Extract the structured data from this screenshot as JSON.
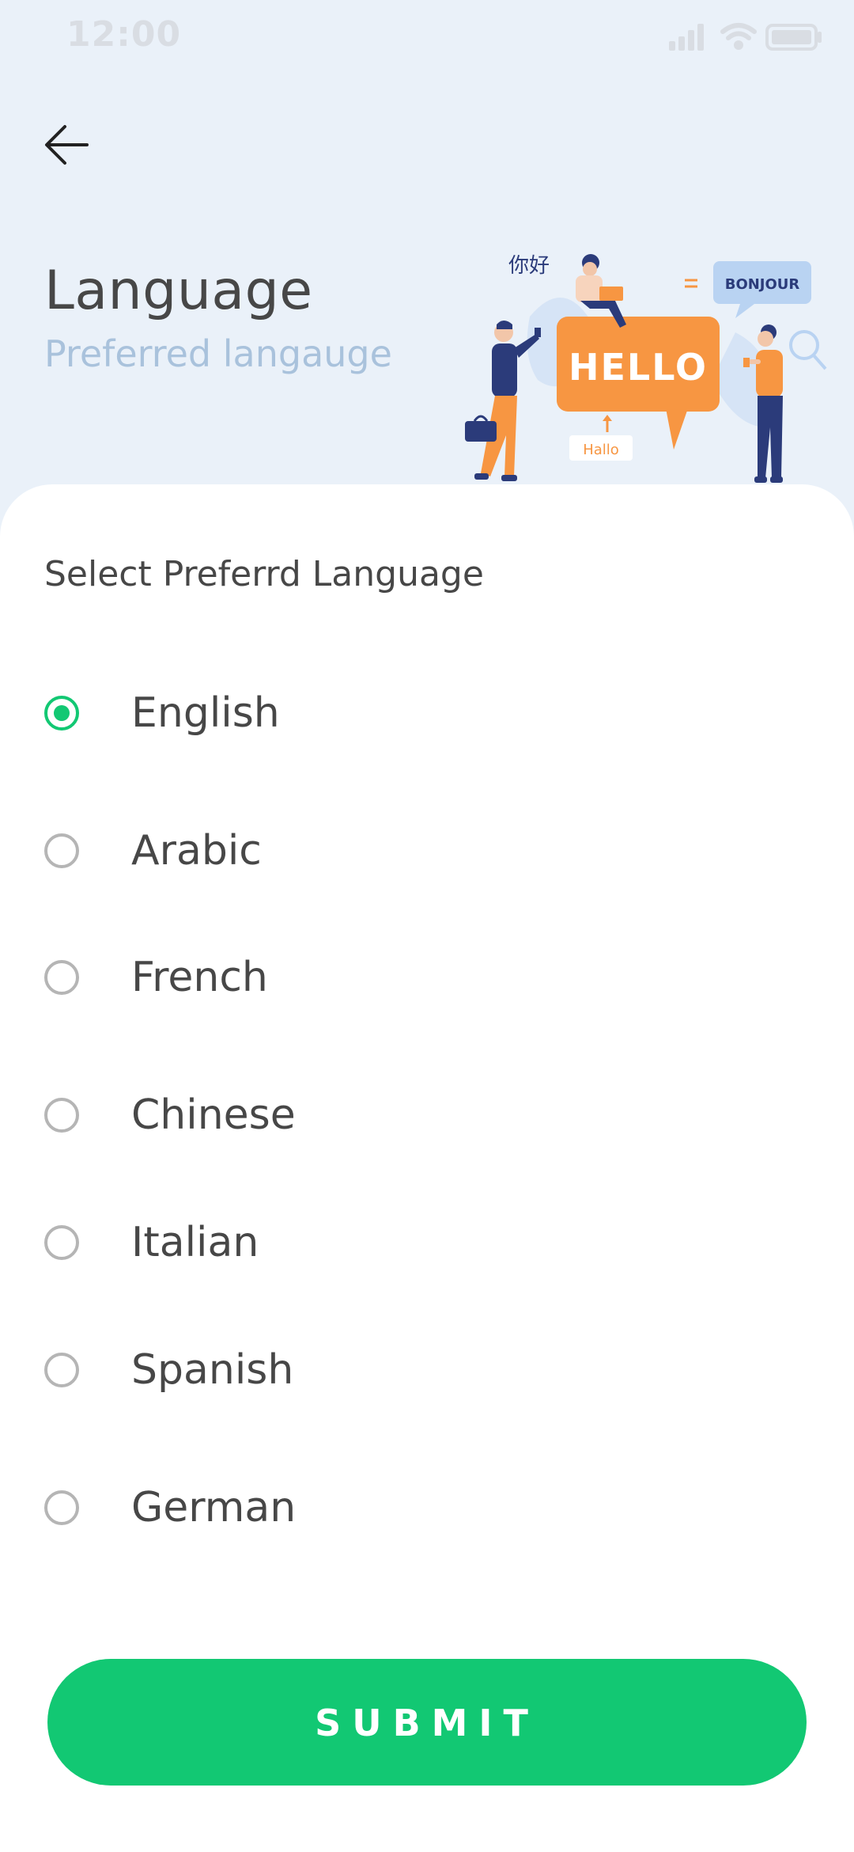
{
  "status_bar": {
    "time": "12:00",
    "icons": [
      "signal-icon",
      "wifi-icon",
      "battery-icon"
    ]
  },
  "header": {
    "back_icon": "arrow-left-icon",
    "title": "Language",
    "subtitle": "Preferred langauge"
  },
  "illustration": {
    "greetings": [
      "你好",
      "BONJOUR",
      "HELLO",
      "Hallo"
    ]
  },
  "form": {
    "label": "Select Preferrd Language",
    "selected": "English",
    "options": [
      {
        "label": "English",
        "checked": true
      },
      {
        "label": "Arabic",
        "checked": false
      },
      {
        "label": "French",
        "checked": false
      },
      {
        "label": "Chinese",
        "checked": false
      },
      {
        "label": "Italian",
        "checked": false
      },
      {
        "label": "Spanish",
        "checked": false
      },
      {
        "label": "German",
        "checked": false
      }
    ],
    "submit_label": "SUBMIT"
  },
  "colors": {
    "accent": "#12c873",
    "background": "#eaf1f9",
    "illustration_orange": "#f79642",
    "illustration_navy": "#2b3b7a",
    "subtitle": "#a9c2dc"
  }
}
